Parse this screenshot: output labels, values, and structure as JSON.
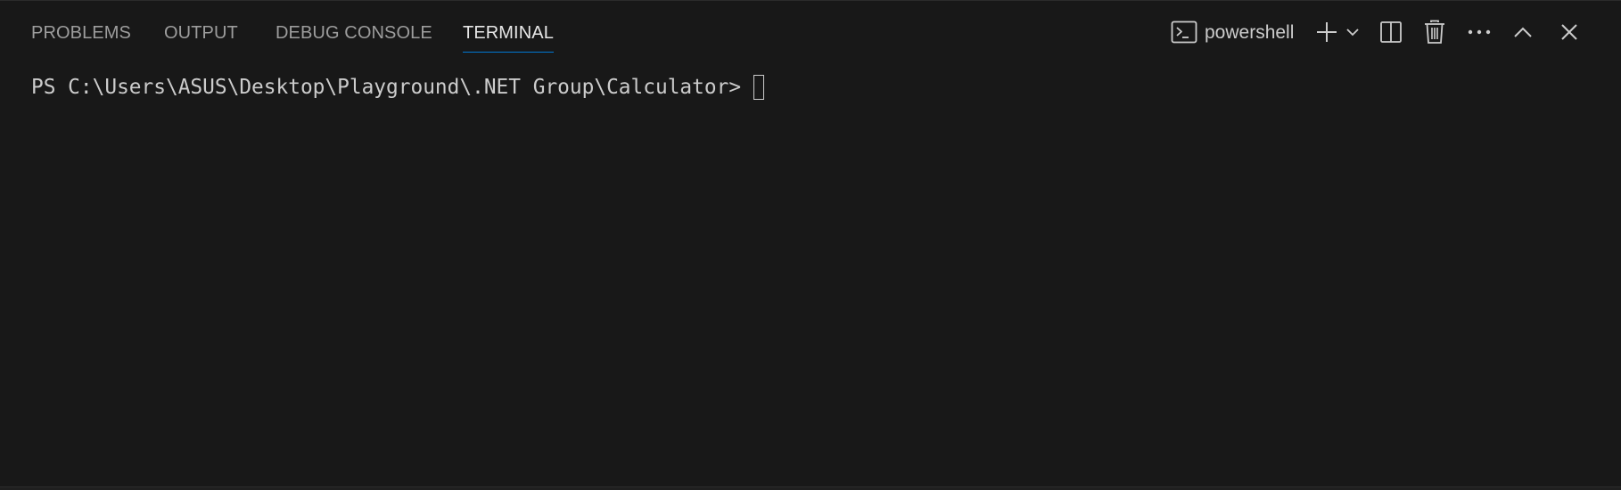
{
  "panel": {
    "tabs": [
      {
        "label": "PROBLEMS",
        "active": false
      },
      {
        "label": "OUTPUT",
        "active": false
      },
      {
        "label": "DEBUG CONSOLE",
        "active": false
      },
      {
        "label": "TERMINAL",
        "active": true
      }
    ],
    "actions": {
      "shell_label": "powershell",
      "icons": [
        "terminal-icon",
        "add-icon",
        "chevron-down-icon",
        "split-icon",
        "trash-icon",
        "ellipsis-icon",
        "chevron-up-icon",
        "close-icon"
      ]
    }
  },
  "terminal": {
    "prompt": "PS C:\\Users\\ASUS\\Desktop\\Playground\\.NET Group\\Calculator>"
  },
  "colors": {
    "background": "#181818",
    "tab_inactive": "#9d9d9d",
    "tab_active": "#e7e7e7",
    "accent": "#0078d4",
    "text": "#cccccc"
  }
}
